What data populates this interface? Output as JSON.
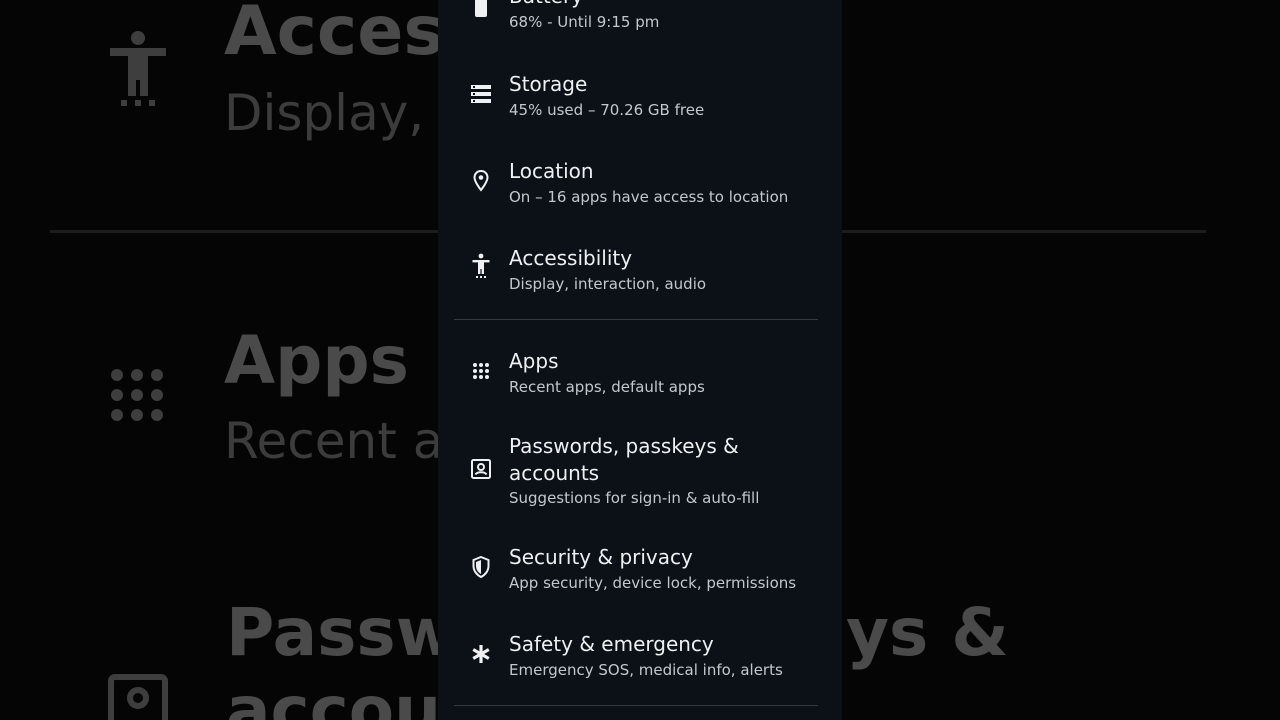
{
  "background": {
    "accessibility_title": "Access",
    "accessibility_sub": "Display, in",
    "apps_title": "Apps",
    "apps_sub": "Recent ap",
    "passwords_title_left": "Passwo",
    "passwords_title_right": "ys &",
    "passwords_title_line2": "accoun"
  },
  "settings": {
    "battery": {
      "title": "Battery",
      "subtitle": "68% - Until 9:15 pm",
      "icon": "battery-icon"
    },
    "storage": {
      "title": "Storage",
      "subtitle": "45% used – 70.26 GB free",
      "icon": "storage-icon"
    },
    "location": {
      "title": "Location",
      "subtitle": "On – 16 apps have access to location",
      "icon": "location-pin-icon"
    },
    "accessibility": {
      "title": "Accessibility",
      "subtitle": "Display, interaction, audio",
      "icon": "accessibility-icon"
    },
    "apps": {
      "title": "Apps",
      "subtitle": "Recent apps, default apps",
      "icon": "apps-grid-icon"
    },
    "passwords": {
      "title_line1": "Passwords, passkeys &",
      "title_line2": "accounts",
      "subtitle": "Suggestions for sign-in & auto-fill",
      "icon": "account-box-icon"
    },
    "security": {
      "title": "Security & privacy",
      "subtitle": "App security, device lock, permissions",
      "icon": "shield-icon"
    },
    "safety": {
      "title": "Safety & emergency",
      "subtitle": "Emergency SOS, medical info, alerts",
      "icon": "asterisk-icon"
    }
  },
  "colors": {
    "panel_bg": "#0b1117",
    "text_primary": "#eef0f2",
    "text_secondary": "#c4c8cc"
  }
}
